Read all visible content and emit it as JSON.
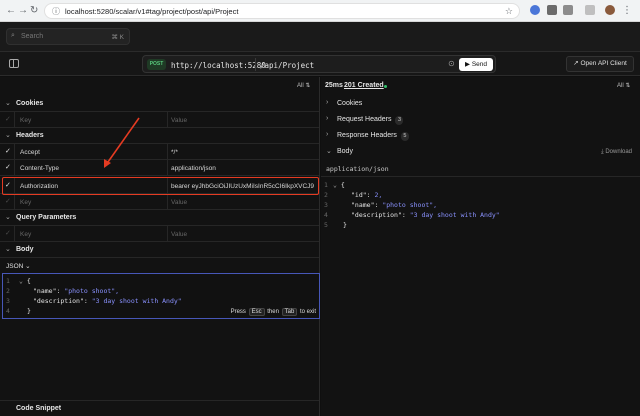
{
  "browser": {
    "url": "localhost:5280/scalar/v1#tag/project/post/api/Project"
  },
  "topbar": {
    "search_placeholder": "Search",
    "search_shortcut": "⌘ K"
  },
  "request_bar": {
    "method": "POST",
    "host": "http://localhost:5280",
    "path": "/api/Project",
    "send_label": "Send",
    "open_api_label": "Open API Client"
  },
  "left": {
    "all_label": "All",
    "cookies": {
      "title": "Cookies",
      "key_placeholder": "Key",
      "value_placeholder": "Value"
    },
    "headers": {
      "title": "Headers",
      "rows": [
        {
          "key": "Accept",
          "value": "*/*"
        },
        {
          "key": "Content-Type",
          "value": "application/json"
        },
        {
          "key": "Authorization",
          "value": "bearer eyJhbGciOiJIUzUxMiIsInR5cCI6IkpXVCJ9"
        }
      ],
      "key_placeholder": "Key",
      "value_placeholder": "Value"
    },
    "query": {
      "title": "Query Parameters",
      "key_placeholder": "Key",
      "value_placeholder": "Value"
    },
    "body": {
      "title": "Body",
      "format": "JSON",
      "hint_press": "Press",
      "hint_esc": "Esc",
      "hint_then": "then",
      "hint_tab": "Tab",
      "hint_exit": "to exit",
      "lines": [
        {
          "num": "1",
          "text": "{"
        },
        {
          "num": "2",
          "key": "\"name\"",
          "val": "\"photo shoot\","
        },
        {
          "num": "3",
          "key": "\"description\"",
          "val": "\"3 day shoot with Andy\""
        },
        {
          "num": "4",
          "text": "}"
        }
      ]
    },
    "snippet_title": "Code Snippet"
  },
  "right": {
    "time": "25ms",
    "status": "201 Created",
    "all_label": "All",
    "cookies_title": "Cookies",
    "req_headers_title": "Request Headers",
    "req_headers_count": "3",
    "resp_headers_title": "Response Headers",
    "resp_headers_count": "5",
    "body_title": "Body",
    "download_label": "Download",
    "content_type": "application/json",
    "lines": [
      {
        "num": "1",
        "text": "{"
      },
      {
        "num": "2",
        "key": "\"id\"",
        "val": "2,"
      },
      {
        "num": "3",
        "key": "\"name\"",
        "val": "\"photo shoot\","
      },
      {
        "num": "4",
        "key": "\"description\"",
        "val": "\"3 day shoot with Andy\""
      },
      {
        "num": "5",
        "text": "}"
      }
    ]
  }
}
